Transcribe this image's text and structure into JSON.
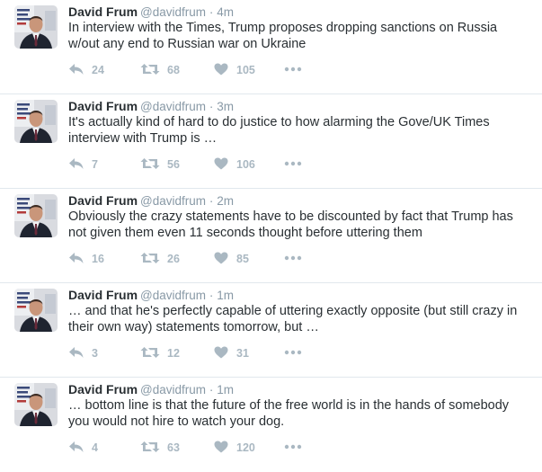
{
  "tweets": [
    {
      "author_name": "David Frum",
      "handle": "@davidfrum",
      "separator": "·",
      "time": "4m",
      "text": "In interview with the Times, Trump proposes dropping sanctions on Russia w/out any end to Russian war on Ukraine",
      "replies": "24",
      "retweets": "68",
      "likes": "105"
    },
    {
      "author_name": "David Frum",
      "handle": "@davidfrum",
      "separator": "·",
      "time": "3m",
      "text": "It's actually kind of hard to do justice to how alarming the Gove/UK Times interview with Trump is …",
      "replies": "7",
      "retweets": "56",
      "likes": "106"
    },
    {
      "author_name": "David Frum",
      "handle": "@davidfrum",
      "separator": "·",
      "time": "2m",
      "text": "Obviously the crazy statements have to be discounted by fact that Trump has not given them even 11 seconds thought before uttering them",
      "replies": "16",
      "retweets": "26",
      "likes": "85"
    },
    {
      "author_name": "David Frum",
      "handle": "@davidfrum",
      "separator": "·",
      "time": "1m",
      "text": "… and that he's perfectly capable of uttering exactly opposite (but still crazy in their own way) statements tomorrow, but …",
      "replies": "3",
      "retweets": "12",
      "likes": "31"
    },
    {
      "author_name": "David Frum",
      "handle": "@davidfrum",
      "separator": "·",
      "time": "1m",
      "text": "… bottom line is that the future of the free world is in the hands of somebody you would not hire to watch your dog.",
      "replies": "4",
      "retweets": "63",
      "likes": "120"
    }
  ],
  "icons": {
    "reply": "reply-icon",
    "retweet": "retweet-icon",
    "like": "heart-icon",
    "more": "more-dots-icon"
  },
  "colors": {
    "action_gray": "#aab8c2",
    "secondary_text": "#8899a6",
    "primary_text": "#292f33",
    "divider": "#e1e8ed"
  }
}
